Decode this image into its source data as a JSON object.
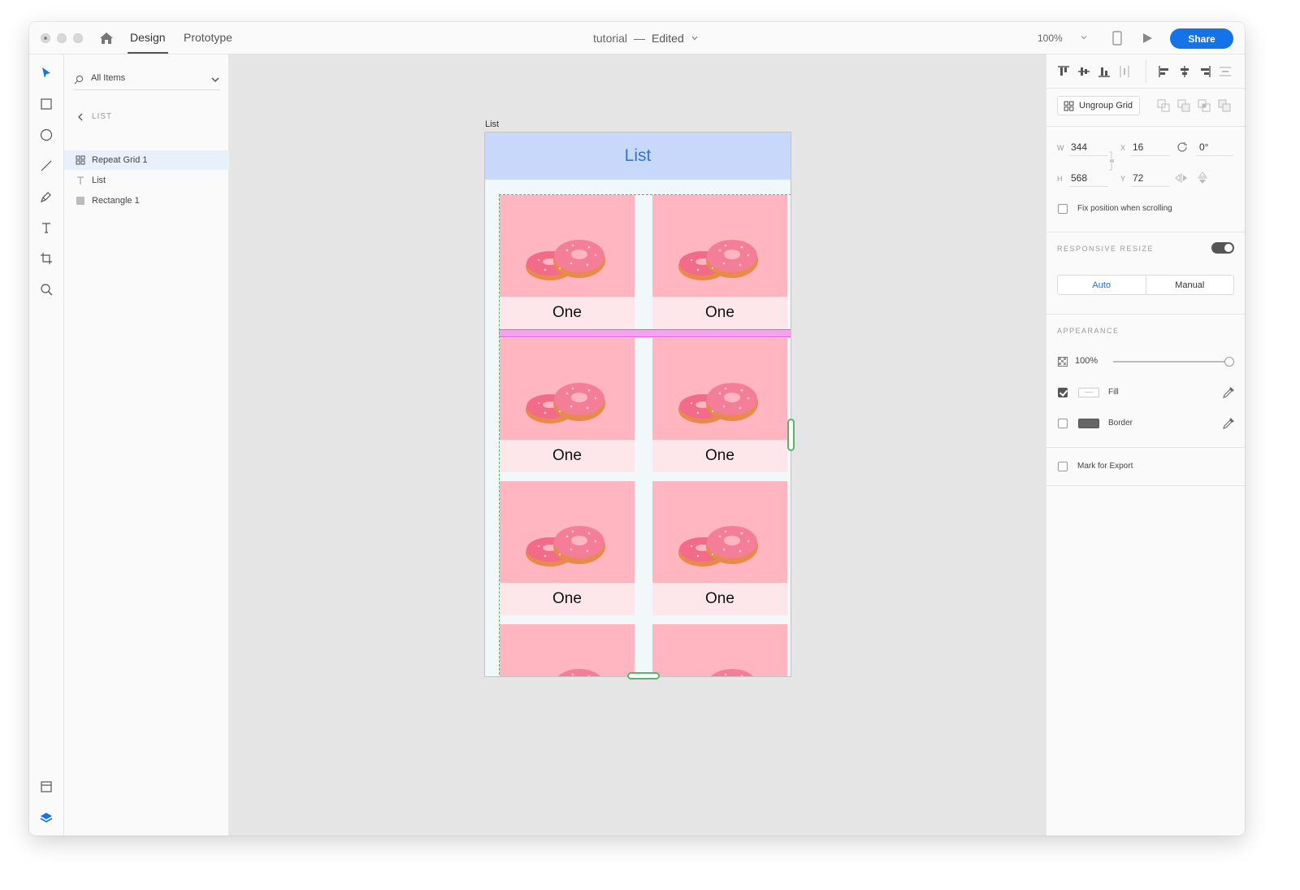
{
  "titlebar": {
    "tabs": [
      "Design",
      "Prototype"
    ],
    "doc_name": "tutorial",
    "doc_sep": "—",
    "doc_status": "Edited",
    "zoom": "100%",
    "share_label": "Share"
  },
  "tools": [
    "select-arrow-icon",
    "rectangle-icon",
    "ellipse-icon",
    "line-icon",
    "pen-icon",
    "text-icon",
    "artboard-icon",
    "zoom-icon",
    "assets-icon",
    "layers-icon"
  ],
  "layers": {
    "filter_label": "All Items",
    "breadcrumb": "LIST",
    "items": [
      {
        "label": "Repeat Grid 1",
        "icon": "repeat-grid-icon",
        "selected": true
      },
      {
        "label": "List",
        "icon": "text-layer-icon",
        "selected": false
      },
      {
        "label": "Rectangle 1",
        "icon": "rectangle-layer-icon",
        "selected": false
      }
    ]
  },
  "canvas": {
    "artboard_label": "List",
    "header_title": "List",
    "cell_caption": "One",
    "colors": {
      "header_bg": "#c7d8fb",
      "header_text": "#3278c8",
      "photo_bg": "#ffb6c1",
      "caption_bg": "#fde7ea",
      "grid_outline": "#5ab46e",
      "gap_highlight": "#f5a3ef"
    }
  },
  "props": {
    "ungroup_label": "Ungroup Grid",
    "w_label": "W",
    "w_value": "344",
    "h_label": "H",
    "h_value": "568",
    "x_label": "X",
    "x_value": "16",
    "y_label": "Y",
    "y_value": "72",
    "rotation": "0°",
    "fix_position_label": "Fix position when scrolling",
    "responsive_title": "RESPONSIVE RESIZE",
    "responsive_on": true,
    "seg_auto": "Auto",
    "seg_manual": "Manual",
    "appearance_title": "APPEARANCE",
    "opacity": "100%",
    "fill_label": "Fill",
    "fill_checked": true,
    "border_label": "Border",
    "border_checked": false,
    "export_label": "Mark for Export",
    "colors": {
      "accent": "#1473e6",
      "border_swatch": "#666666",
      "fill_swatch": "#ffffff"
    }
  }
}
